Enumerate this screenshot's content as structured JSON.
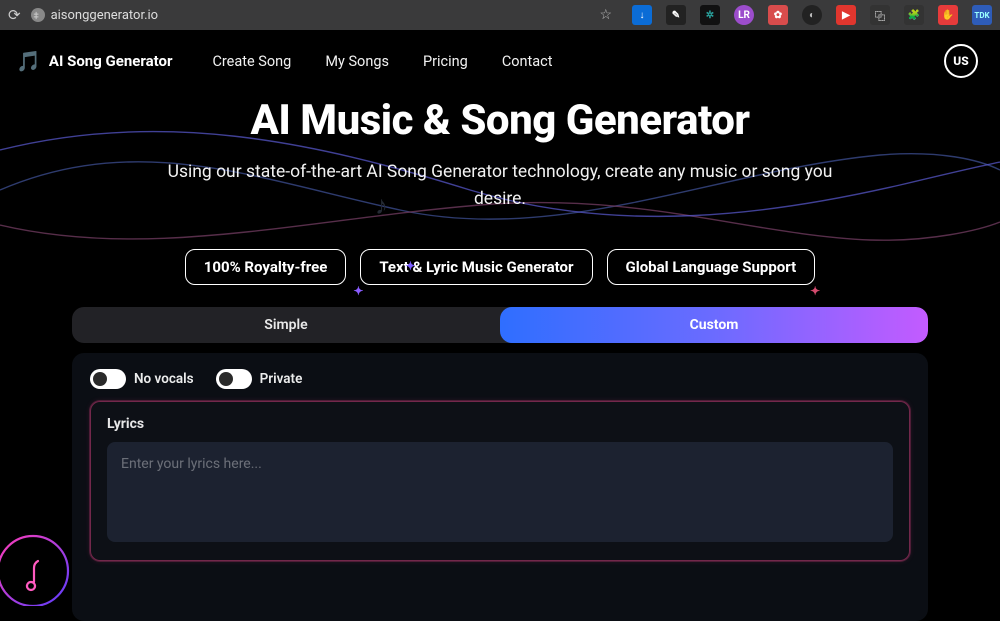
{
  "browser": {
    "url": "aisonggenerator.io"
  },
  "header": {
    "brand": "AI Song Generator",
    "nav": {
      "create": "Create Song",
      "mysongs": "My Songs",
      "pricing": "Pricing",
      "contact": "Contact"
    },
    "user_initials": "US"
  },
  "hero": {
    "title": "AI Music & Song Generator",
    "subtitle": "Using our state-of-the-art AI Song Generator technology, create any music or song you desire."
  },
  "features": {
    "royalty": "100% Royalty-free",
    "generator": "Text & Lyric Music Generator",
    "global": "Global Language Support"
  },
  "tabs": {
    "simple": "Simple",
    "custom": "Custom",
    "active": "custom"
  },
  "toggles": {
    "novocals_label": "No vocals",
    "novocals_on": false,
    "private_label": "Private",
    "private_on": false
  },
  "lyrics": {
    "label": "Lyrics",
    "placeholder": "Enter your lyrics here...",
    "value": ""
  }
}
